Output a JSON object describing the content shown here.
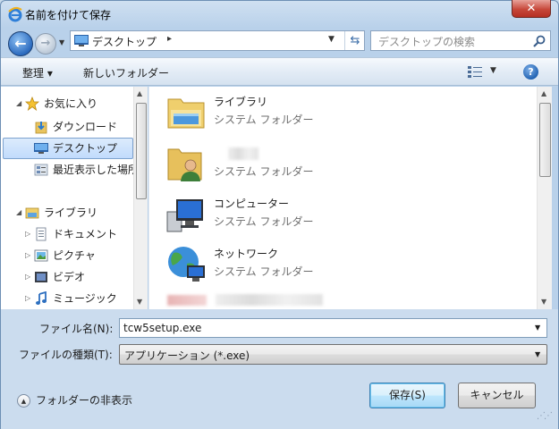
{
  "window": {
    "title": "名前を付けて保存",
    "close_label": "✕"
  },
  "nav": {
    "back_glyph": "←",
    "forward_glyph": "→",
    "address": "デスクトップ",
    "address_separator": "▸",
    "search_placeholder": "デスクトップの検索"
  },
  "toolbar": {
    "organize": "整理 ▾",
    "new_folder": "新しいフォルダー",
    "help": "?"
  },
  "sidebar": {
    "favorites": "お気に入り",
    "favorite_items": [
      "ダウンロード",
      "デスクトップ",
      "最近表示した場所"
    ],
    "libraries": "ライブラリ",
    "library_items": [
      "ドキュメント",
      "ピクチャ",
      "ビデオ",
      "ミュージック"
    ],
    "selected": "デスクトップ"
  },
  "files": [
    {
      "name": "ライブラリ",
      "type": "システム フォルダー",
      "icon": "library-folder-icon"
    },
    {
      "name": "",
      "type": "システム フォルダー",
      "icon": "user-folder-icon"
    },
    {
      "name": "コンピューター",
      "type": "システム フォルダー",
      "icon": "computer-icon"
    },
    {
      "name": "ネットワーク",
      "type": "システム フォルダー",
      "icon": "network-icon"
    }
  ],
  "form": {
    "filename_label": "ファイル名(N):",
    "filename_value": "tcw5setup.exe",
    "filetype_label": "ファイルの種類(T):",
    "filetype_value": "アプリケーション (*.exe)"
  },
  "buttons": {
    "hide_folders": "フォルダーの非表示",
    "save": "保存(S)",
    "cancel": "キャンセル"
  }
}
